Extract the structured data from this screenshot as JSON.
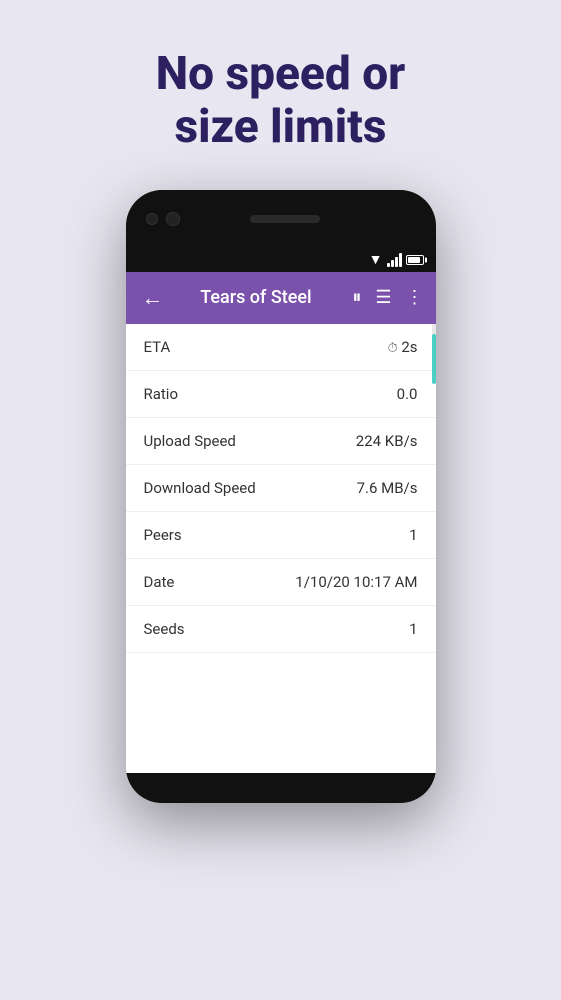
{
  "page": {
    "background_color": "#e8e6f0",
    "headline": "No speed or\nsize limits"
  },
  "phone": {
    "toolbar": {
      "title": "Tears of Steel",
      "back_label": "←",
      "pause_label": "⏸",
      "list_label": "☰",
      "more_label": "⋮",
      "color": "#7b52ab"
    },
    "rows": [
      {
        "label": "ETA",
        "value": "2s",
        "has_clock": true
      },
      {
        "label": "Ratio",
        "value": "0.0"
      },
      {
        "label": "Upload Speed",
        "value": "224 KB/s"
      },
      {
        "label": "Download Speed",
        "value": "7.6 MB/s"
      },
      {
        "label": "Peers",
        "value": "1"
      },
      {
        "label": "Date",
        "value": "1/10/20 10:17 AM"
      },
      {
        "label": "Seeds",
        "value": "1"
      }
    ]
  }
}
